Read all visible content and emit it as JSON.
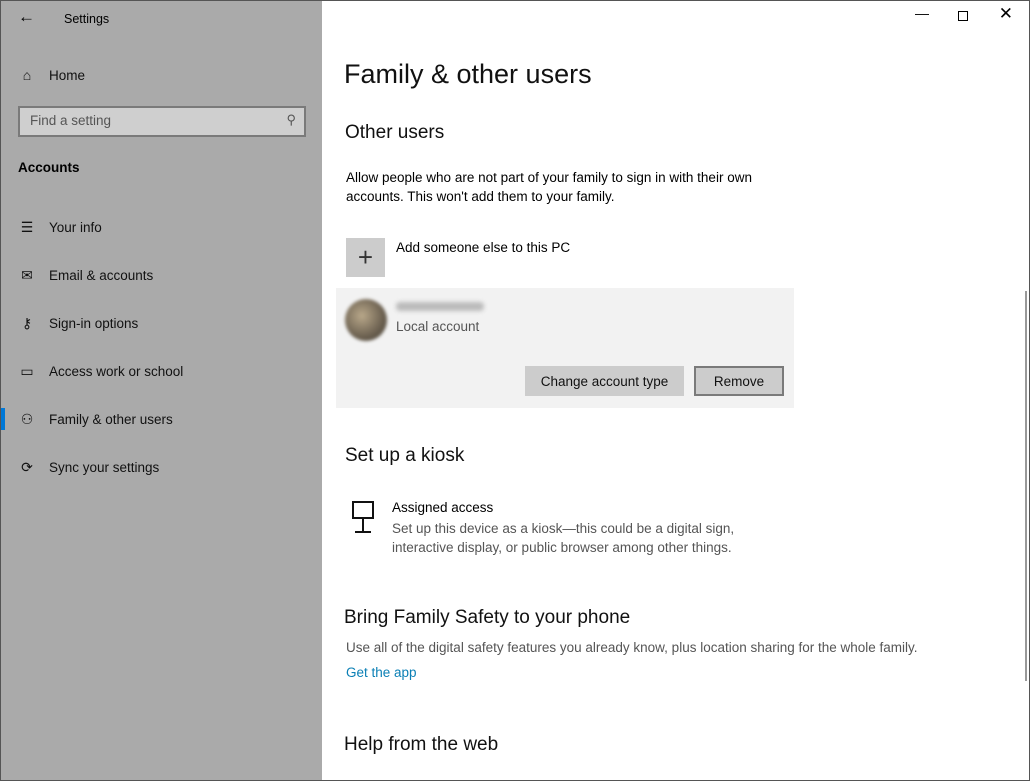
{
  "window": {
    "title": "Settings",
    "controls": [
      "minimize",
      "maximize",
      "close"
    ]
  },
  "sidebar": {
    "home": "Home",
    "search": {
      "placeholder": "Find a setting"
    },
    "section": "Accounts",
    "items": [
      {
        "label": "Your info",
        "icon": "person-card-icon"
      },
      {
        "label": "Email & accounts",
        "icon": "mail-icon"
      },
      {
        "label": "Sign-in options",
        "icon": "key-icon"
      },
      {
        "label": "Access work or school",
        "icon": "briefcase-icon"
      },
      {
        "label": "Family & other users",
        "icon": "person-add-icon",
        "selected": true
      },
      {
        "label": "Sync your settings",
        "icon": "sync-icon"
      }
    ],
    "accent": "#0078d7"
  },
  "main": {
    "title": "Family & other users",
    "other_users": {
      "heading": "Other users",
      "description": "Allow people who are not part of your family to sign in with their own accounts. This won't add them to your family.",
      "add_label": "Add someone else to this PC",
      "account": {
        "type": "Local account",
        "change_button": "Change account type",
        "remove_button": "Remove"
      }
    },
    "kiosk": {
      "heading": "Set up a kiosk",
      "title": "Assigned access",
      "description": "Set up this device as a kiosk—this could be a digital sign, interactive display, or public browser among other things."
    },
    "family_safety": {
      "heading": "Bring Family Safety to your phone",
      "description": "Use all of the digital safety features you already know, plus location sharing for the whole family.",
      "link": "Get the app"
    },
    "help": {
      "heading": "Help from the web"
    }
  }
}
